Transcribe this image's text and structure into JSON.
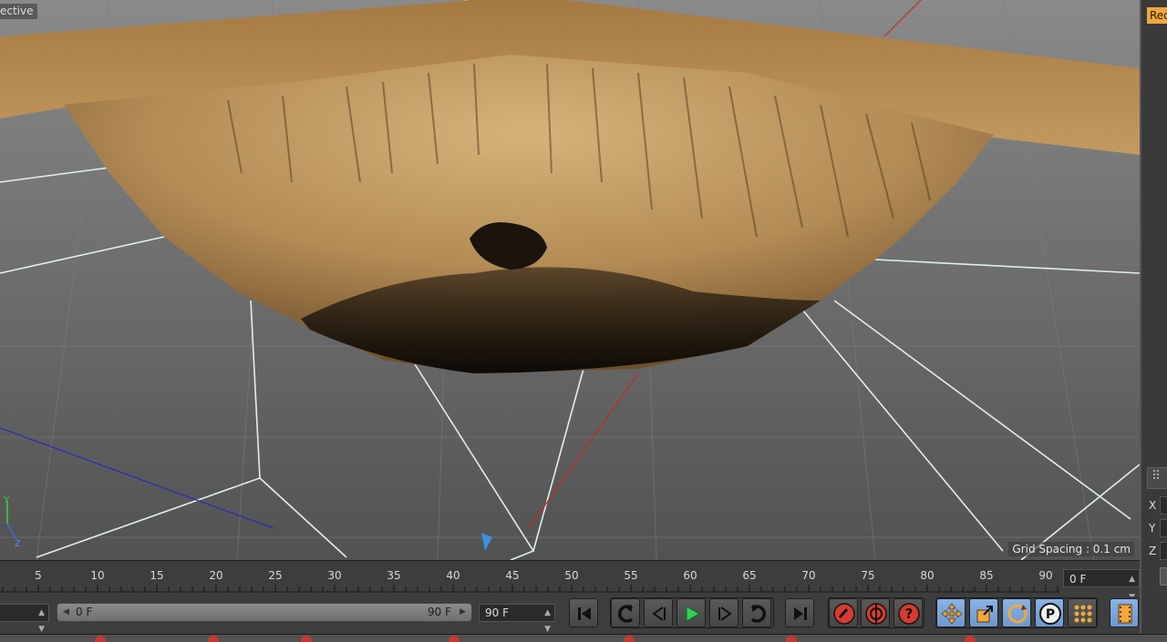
{
  "viewport": {
    "label": "ective",
    "grid_spacing": "Grid Spacing : 0.1 cm",
    "axis_labels": {
      "y": "Y",
      "z": "Z"
    }
  },
  "right_panel": {
    "record_label": "Rec",
    "coords": [
      "X",
      "Y",
      "Z"
    ]
  },
  "timeline": {
    "ticks": [
      "5",
      "10",
      "15",
      "20",
      "25",
      "30",
      "35",
      "40",
      "45",
      "50",
      "55",
      "60",
      "65",
      "70",
      "75",
      "80",
      "85",
      "90"
    ],
    "current_frame": "0 F"
  },
  "transport": {
    "start_field": "",
    "range_start": "0 F",
    "range_end": "90 F",
    "end_field": "90 F",
    "icons": {
      "go_start": "skip-to-start-icon",
      "prev_key": "previous-keyframe-icon",
      "prev_frame": "step-back-icon",
      "play": "play-icon",
      "next_frame": "step-forward-icon",
      "next_key": "next-keyframe-icon",
      "go_end": "skip-to-end-icon",
      "record": "record-keys-icon",
      "autokey": "autokey-icon",
      "help": "help-icon",
      "move": "move-icon",
      "scale": "scale-icon",
      "rotate": "rotate-icon",
      "param": "parameter-icon",
      "pla": "point-level-icon",
      "timeline": "timeline-film-icon"
    },
    "colors": {
      "play": "#2fd15a",
      "record": "#d83a32",
      "accent": "#f2a83a"
    }
  },
  "statusbar": {
    "items": [
      "",
      "",
      "",
      "",
      "",
      "",
      "",
      ""
    ]
  }
}
